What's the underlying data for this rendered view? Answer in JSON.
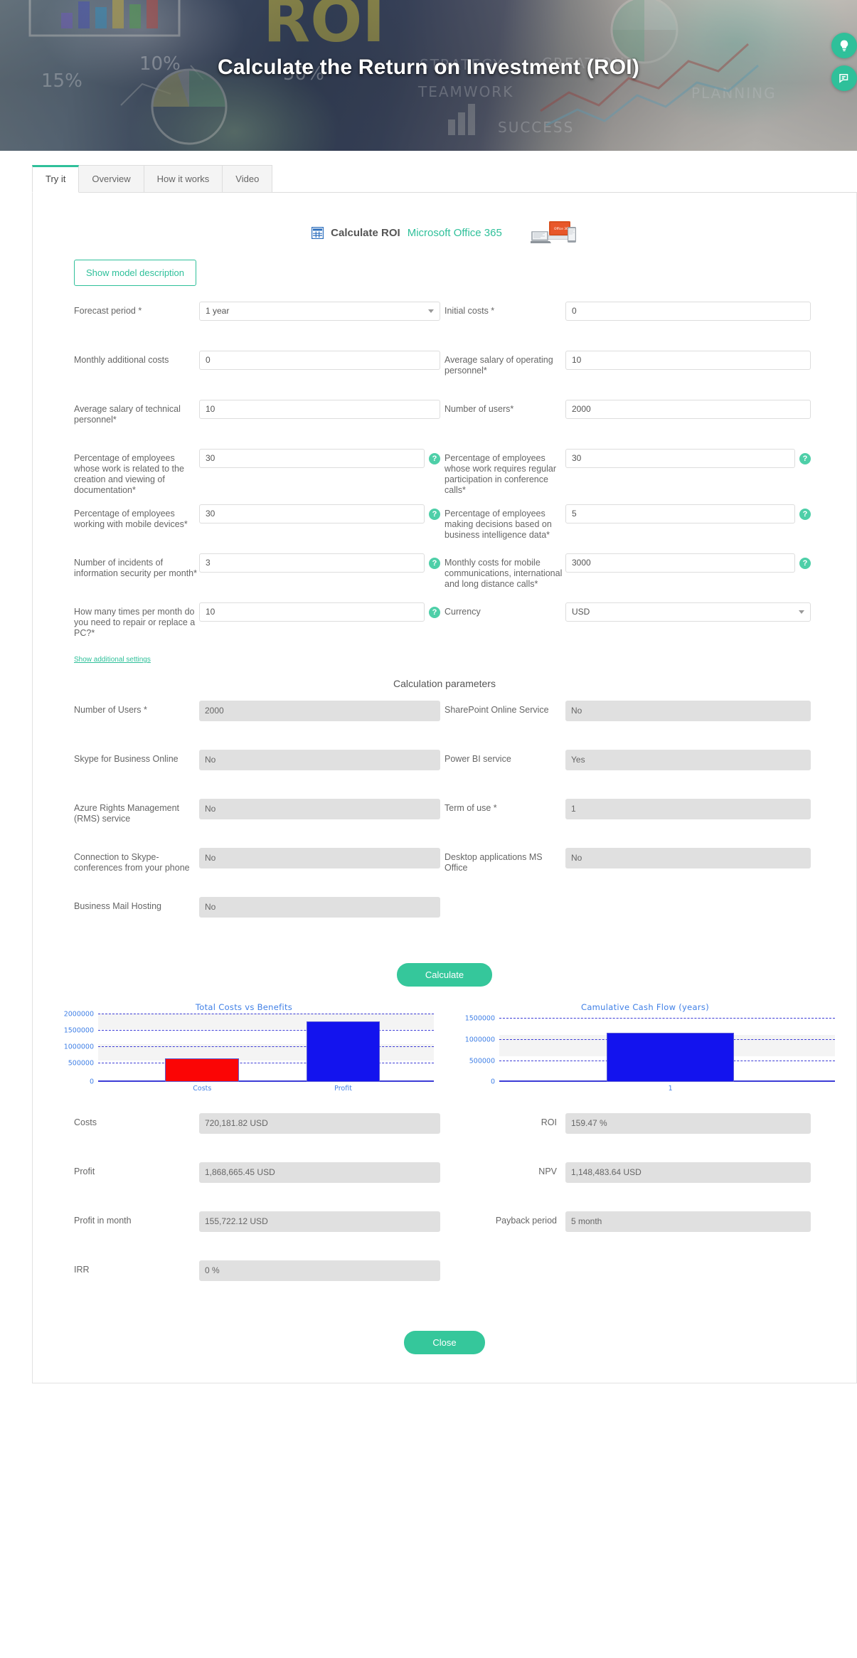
{
  "hero": {
    "title": "Calculate the Return on Investment (ROI)",
    "side_buttons": [
      {
        "name": "lightbulb-icon",
        "label": "Idea"
      },
      {
        "name": "feedback-icon",
        "label": "Feedback"
      }
    ]
  },
  "tabs": [
    {
      "label": "Try it",
      "active": true
    },
    {
      "label": "Overview",
      "active": false
    },
    {
      "label": "How it works",
      "active": false
    },
    {
      "label": "Video",
      "active": false
    }
  ],
  "model": {
    "icon": "spreadsheet-icon",
    "title": "Calculate ROI",
    "subtitle": "Microsoft Office 365",
    "description_button": "Show model description"
  },
  "form": {
    "rows": [
      [
        {
          "label": "Forecast period *",
          "value": "1 year",
          "type": "select",
          "help": false,
          "readonly": false
        },
        {
          "label": "Initial costs *",
          "value": "0",
          "type": "text",
          "help": false,
          "readonly": false
        }
      ],
      [
        {
          "label": "Monthly additional costs",
          "value": "0",
          "type": "text",
          "help": false,
          "readonly": false
        },
        {
          "label": "Average salary of operating personnel*",
          "value": "10",
          "type": "text",
          "help": false,
          "readonly": false
        }
      ],
      [
        {
          "label": "Average salary of technical personnel*",
          "value": "10",
          "type": "text",
          "help": false,
          "readonly": false
        },
        {
          "label": "Number of users*",
          "value": "2000",
          "type": "text",
          "help": false,
          "readonly": false
        }
      ],
      [
        {
          "label": "Percentage of employees whose work is related to the creation and viewing of documentation*",
          "value": "30",
          "type": "text",
          "help": true,
          "readonly": false
        },
        {
          "label": "Percentage of employees whose work requires regular participation in conference calls*",
          "value": "30",
          "type": "text",
          "help": true,
          "readonly": false
        }
      ],
      [
        {
          "label": "Percentage of employees working with mobile devices*",
          "value": "30",
          "type": "text",
          "help": true,
          "readonly": false
        },
        {
          "label": "Percentage of employees making decisions based on business intelligence data*",
          "value": "5",
          "type": "text",
          "help": true,
          "readonly": false
        }
      ],
      [
        {
          "label": "Number of incidents of information security per month*",
          "value": "3",
          "type": "text",
          "help": true,
          "readonly": false
        },
        {
          "label": "Monthly costs for mobile communications, international and long distance calls*",
          "value": "3000",
          "type": "text",
          "help": true,
          "readonly": false
        }
      ],
      [
        {
          "label": "How many times per month do you need to repair or replace a PC?*",
          "value": "10",
          "type": "text",
          "help": true,
          "readonly": false
        },
        {
          "label": "Currency",
          "value": "USD",
          "type": "select",
          "help": false,
          "readonly": false
        }
      ]
    ],
    "additional_settings_link": "Show additional settings"
  },
  "calc_params": {
    "title": "Calculation parameters",
    "rows": [
      [
        {
          "label": "Number of Users *",
          "value": "2000"
        },
        {
          "label": "SharePoint Online Service",
          "value": "No"
        }
      ],
      [
        {
          "label": "Skype for Business Online",
          "value": "No"
        },
        {
          "label": "Power BI service",
          "value": "Yes"
        }
      ],
      [
        {
          "label": "Azure Rights Management (RMS) service",
          "value": "No"
        },
        {
          "label": "Term of use *",
          "value": "1"
        }
      ],
      [
        {
          "label": "Connection to Skype-conferences from your phone",
          "value": "No"
        },
        {
          "label": "Desktop applications MS Office",
          "value": "No"
        }
      ],
      [
        {
          "label": "Business Mail Hosting",
          "value": "No"
        },
        {
          "label": "",
          "value": ""
        }
      ]
    ]
  },
  "calculate_button": "Calculate",
  "close_button": "Close",
  "chart_data": [
    {
      "type": "bar",
      "title": "Total Costs vs Benefits",
      "categories": [
        "Costs",
        "Profit"
      ],
      "values": [
        720181.82,
        1868665.45
      ],
      "ticks": [
        0,
        500000,
        1000000,
        1500000,
        2000000
      ],
      "tick_labels": [
        "0",
        "500000",
        "1000000",
        "1500000",
        "2000000"
      ],
      "ylim": [
        0,
        2100000
      ],
      "colors": [
        "#fb0505",
        "#1313ee"
      ],
      "xlabel": "",
      "ylabel": "",
      "grid": true,
      "legend": "none"
    },
    {
      "type": "bar",
      "title": "Camulative Cash Flow (years)",
      "categories": [
        "1"
      ],
      "values": [
        1148483.64
      ],
      "ticks": [
        0,
        500000,
        1000000,
        1500000
      ],
      "tick_labels": [
        "0",
        "500000",
        "1000000",
        "1500000"
      ],
      "ylim": [
        0,
        1600000
      ],
      "colors": [
        "#1313ee"
      ],
      "xlabel": "",
      "ylabel": "",
      "grid": true,
      "legend": "none"
    }
  ],
  "results": {
    "rows": [
      [
        {
          "label": "Costs",
          "value": "720,181.82 USD"
        },
        {
          "label": "ROI",
          "value": "159.47 %"
        }
      ],
      [
        {
          "label": "Profit",
          "value": "1,868,665.45 USD"
        },
        {
          "label": "NPV",
          "value": "1,148,483.64 USD"
        }
      ],
      [
        {
          "label": "Profit in month",
          "value": "155,722.12 USD"
        },
        {
          "label": "Payback period",
          "value": "5 month"
        }
      ],
      [
        {
          "label": "IRR",
          "value": "0 %"
        },
        {
          "label": "",
          "value": ""
        }
      ]
    ]
  }
}
